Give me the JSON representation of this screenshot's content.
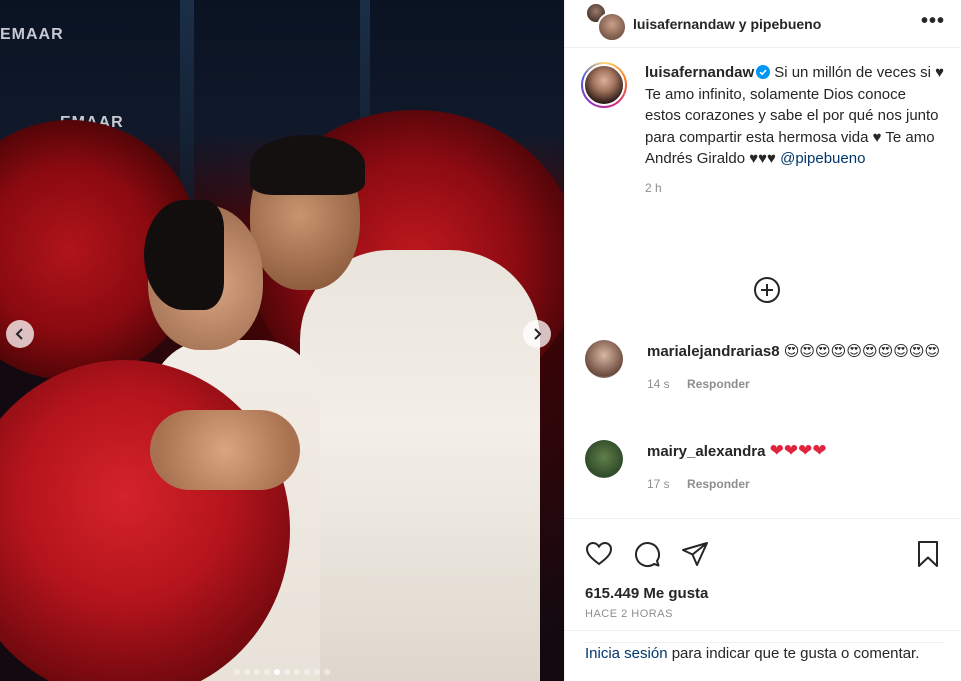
{
  "post": {
    "header_title": "luisafernandaw y pipebueno",
    "more_label": "•••",
    "photo": {
      "signs": [
        "EMAAR",
        "EMAAR"
      ],
      "carousel_index": 5,
      "carousel_count": 10
    }
  },
  "caption": {
    "username": "luisafernandaw",
    "text_line1": "Si un millón de veces si ♥",
    "text_line2": "Te amo infinito, solamente Dios conoce estos corazones y sabe el por qué nos junto para compartir esta hermosa vida ♥ Te amo Andrés Giraldo ♥♥♥",
    "mention": "@pipebueno",
    "time": "2 h"
  },
  "comments": [
    {
      "username": "marialejandrarias8",
      "text": "😍😍😍😍😍😍😍😍😍😍",
      "time": "14 s",
      "reply": "Responder"
    },
    {
      "username": "mairy_alexandra",
      "text": "❤❤❤❤",
      "time": "17 s",
      "reply": "Responder"
    }
  ],
  "actions": {
    "like_icon": "heart-outline-icon",
    "comment_icon": "comment-bubble-icon",
    "share_icon": "paper-plane-icon",
    "save_icon": "bookmark-icon"
  },
  "likes": "615.449 Me gusta",
  "ago": "HACE 2 HORAS",
  "login": {
    "link": "Inicia sesión",
    "rest": "para indicar que te gusta o comentar."
  },
  "colors": {
    "link": "#00376b",
    "muted": "#8e8e8e",
    "verified": "#0095f6",
    "heart": "#e0243e"
  }
}
